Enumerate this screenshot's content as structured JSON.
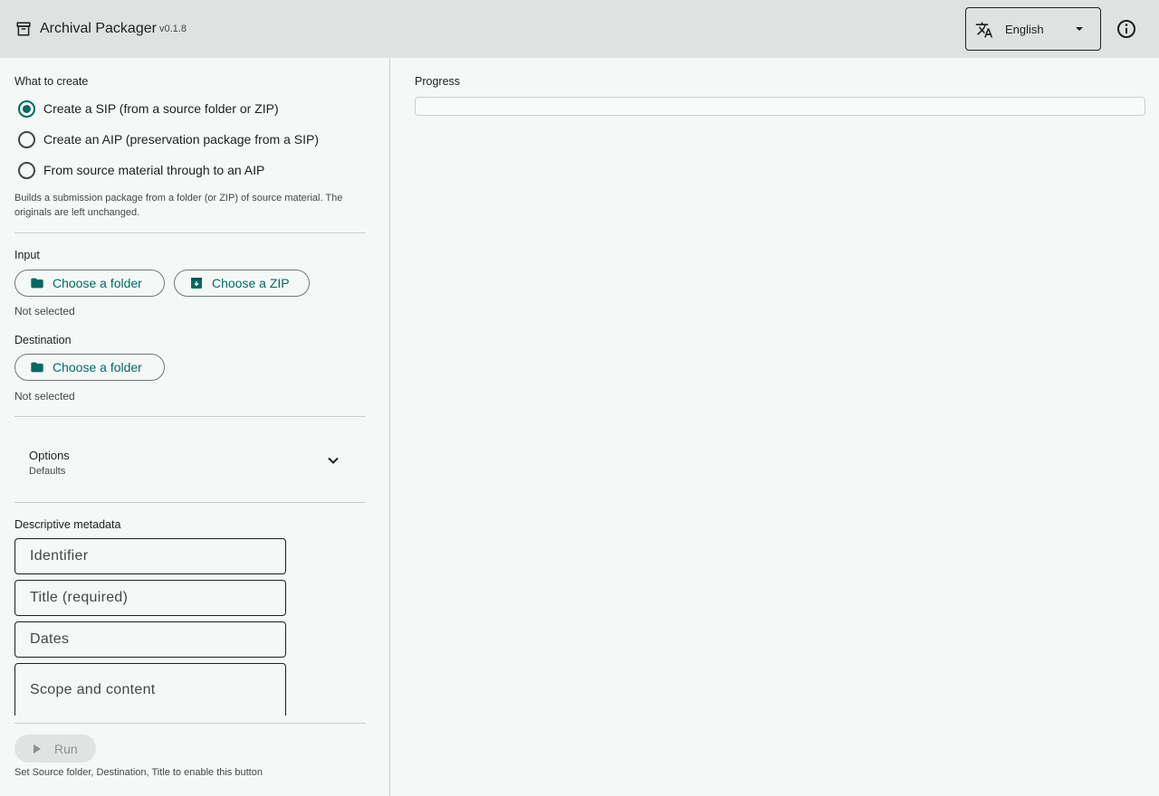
{
  "header": {
    "title": "Archival Packager",
    "version": "v0.1.8",
    "language": {
      "selected": "English"
    },
    "icons": {
      "app": "archive-box-icon",
      "language": "translate-icon",
      "info": "info-icon"
    }
  },
  "mode": {
    "label": "What to create",
    "options": [
      {
        "label": "Create a SIP (from a source folder or ZIP)",
        "checked": true
      },
      {
        "label": "Create an AIP (preservation package from a SIP)",
        "checked": false
      },
      {
        "label": "From source material through to an AIP",
        "checked": false
      }
    ],
    "help": "Builds a submission package from a folder (or ZIP) of source material. The originals are left unchanged."
  },
  "input": {
    "label": "Input",
    "choose_folder": "Choose a folder",
    "choose_zip": "Choose a ZIP",
    "status": "Not selected"
  },
  "destination": {
    "label": "Destination",
    "choose_folder": "Choose a folder",
    "status": "Not selected"
  },
  "options": {
    "title": "Options",
    "subtitle": "Defaults"
  },
  "metadata": {
    "label": "Descriptive metadata",
    "identifier_placeholder": "Identifier",
    "title_placeholder": "Title (required)",
    "dates_placeholder": "Dates",
    "scope_placeholder": "Scope and content"
  },
  "run": {
    "label": "Run",
    "hint": "Set Source folder, Destination, Title to enable this button",
    "enabled": false
  },
  "progress": {
    "label": "Progress",
    "value": 0
  },
  "colors": {
    "accent": "#006a60",
    "header_bg": "#dde3e1",
    "page_bg": "#f4f9f8"
  }
}
